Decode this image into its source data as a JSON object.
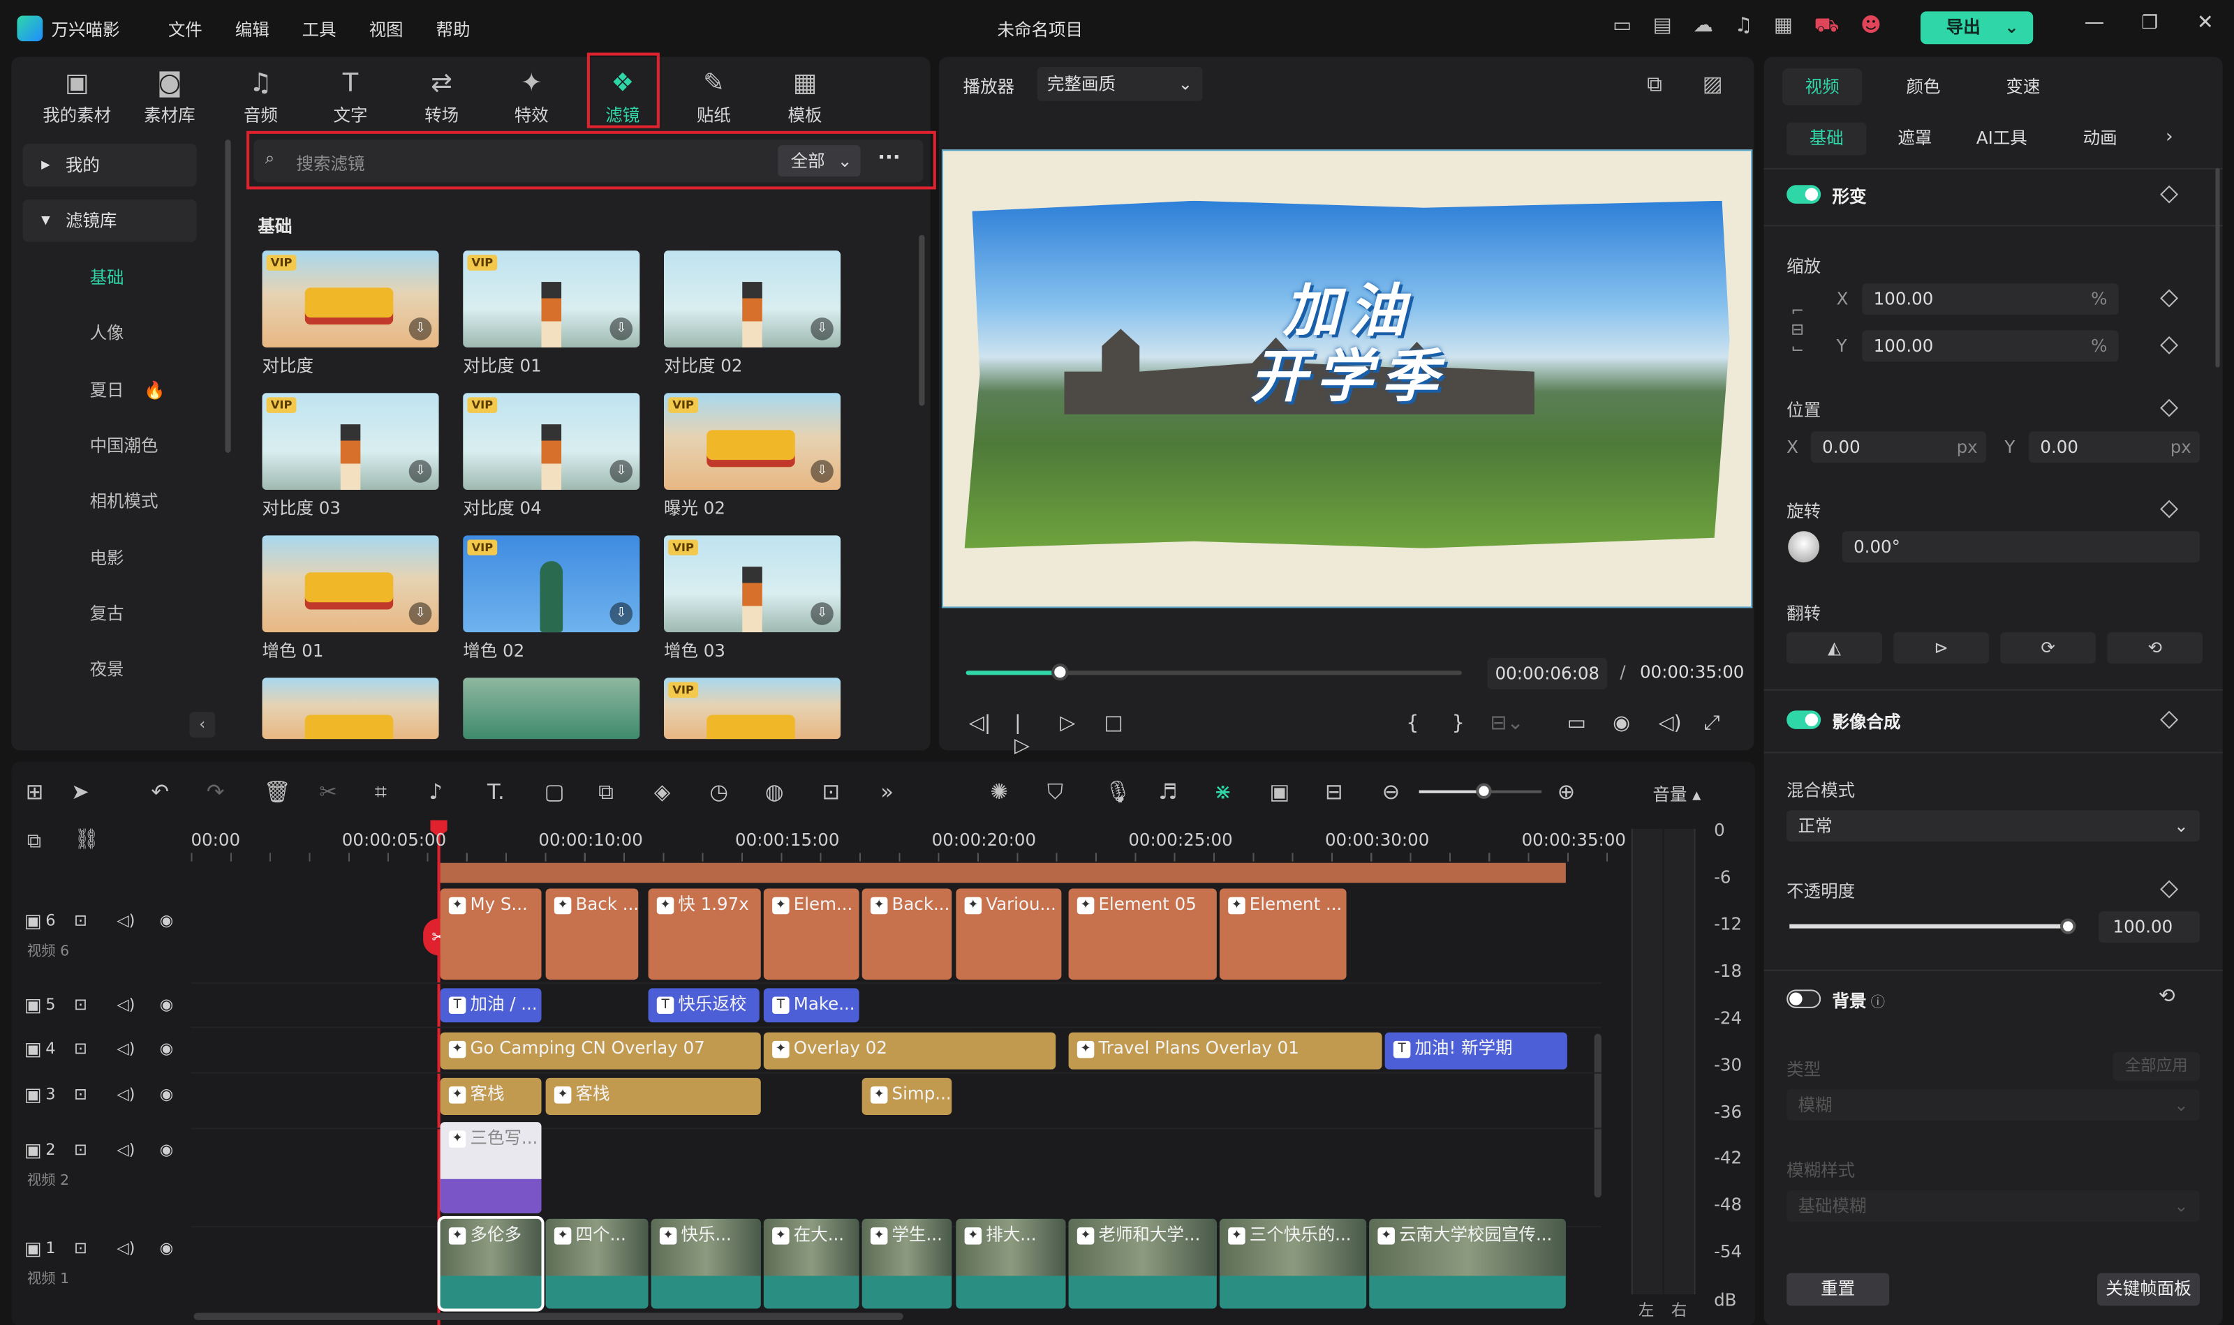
{
  "app": {
    "name": "万兴喵影",
    "project_title": "未命名项目",
    "export_label": "导出"
  },
  "menu": [
    "文件",
    "编辑",
    "工具",
    "视图",
    "帮助"
  ],
  "toolbar": [
    {
      "label": "我的素材",
      "icon": "my-assets-icon",
      "glyph": "▣"
    },
    {
      "label": "素材库",
      "icon": "library-icon",
      "glyph": "◙"
    },
    {
      "label": "音频",
      "icon": "music-note-icon",
      "glyph": "♫"
    },
    {
      "label": "文字",
      "icon": "text-icon",
      "glyph": "T"
    },
    {
      "label": "转场",
      "icon": "transition-icon",
      "glyph": "⇄"
    },
    {
      "label": "特效",
      "icon": "effects-icon",
      "glyph": "✦"
    },
    {
      "label": "滤镜",
      "icon": "filter-icon",
      "glyph": "❖",
      "active": true
    },
    {
      "label": "贴纸",
      "icon": "sticker-icon",
      "glyph": "✎"
    },
    {
      "label": "模板",
      "icon": "template-icon",
      "glyph": "▦"
    }
  ],
  "sidebar": {
    "groups": [
      {
        "label": "我的",
        "expanded": false
      },
      {
        "label": "滤镜库",
        "expanded": true
      }
    ],
    "items": [
      {
        "label": "基础",
        "active": true
      },
      {
        "label": "人像"
      },
      {
        "label": "夏日",
        "badge": "fire-icon"
      },
      {
        "label": "中国潮色"
      },
      {
        "label": "相机模式"
      },
      {
        "label": "电影"
      },
      {
        "label": "复古"
      },
      {
        "label": "夜景"
      }
    ]
  },
  "search": {
    "placeholder": "搜索滤镜",
    "filter_value": "全部",
    "more": "···"
  },
  "section_title": "基础",
  "filters": [
    {
      "label": "对比度",
      "vip": true,
      "scene": "bus"
    },
    {
      "label": "对比度 01",
      "vip": true,
      "scene": "tower"
    },
    {
      "label": "对比度 02",
      "vip": false,
      "scene": "tower"
    },
    {
      "label": "对比度 03",
      "vip": true,
      "scene": "tower"
    },
    {
      "label": "对比度 04",
      "vip": true,
      "scene": "tower"
    },
    {
      "label": "曝光 02",
      "vip": true,
      "scene": "bus"
    },
    {
      "label": "增色 01",
      "vip": false,
      "scene": "bus"
    },
    {
      "label": "增色 02",
      "vip": true,
      "scene": "tennis"
    },
    {
      "label": "增色 03",
      "vip": true,
      "scene": "tower"
    },
    {
      "label": "",
      "vip": false,
      "scene": "bus"
    },
    {
      "label": "",
      "vip": false,
      "scene": "people"
    },
    {
      "label": "",
      "vip": true,
      "scene": "bus"
    }
  ],
  "player": {
    "label": "播放器",
    "quality": "完整画质",
    "current_time": "00:00:06:08",
    "separator": "/",
    "total_time": "00:00:35:00",
    "progress": 0.19,
    "title_line1": "加油",
    "title_line2": "开学季"
  },
  "timeline": {
    "ruler": [
      "00:00",
      "00:00:05:00",
      "00:00:10:00",
      "00:00:15:00",
      "00:00:20:00",
      "00:00:25:00",
      "00:00:30:00",
      "00:00:35:00"
    ],
    "volume_label": "音量",
    "db_scale": [
      "0",
      "-6",
      "-12",
      "-18",
      "-24",
      "-30",
      "-36",
      "-42",
      "-48",
      "-54",
      "dB"
    ],
    "channels": [
      "左",
      "右"
    ],
    "tracks": [
      {
        "num": "6",
        "name": "视频 6"
      },
      {
        "num": "5",
        "name": ""
      },
      {
        "num": "4",
        "name": ""
      },
      {
        "num": "3",
        "name": ""
      },
      {
        "num": "2",
        "name": "视频 2"
      },
      {
        "num": "1",
        "name": "视频 1"
      }
    ],
    "clips": {
      "v6": [
        "My S...",
        "Back ...",
        "快 1.97x",
        "Elem...",
        "Back...",
        "Variou...",
        "Element 05",
        "Element ..."
      ],
      "v5": [
        "加油 / ...",
        "快乐返校",
        "Make..."
      ],
      "v4": [
        "Go Camping CN Overlay 07",
        "Overlay 02",
        "Travel Plans Overlay 01",
        "加油! 新学期"
      ],
      "v3": [
        "客栈",
        "客栈",
        "Simp..."
      ],
      "v2": [
        "三色写..."
      ],
      "v1": [
        "多伦多",
        "四个...",
        "快乐...",
        "在大...",
        "学生...",
        "排大...",
        "老师和大学...",
        "三个快乐的...",
        "云南大学校园宣传..."
      ]
    },
    "vip_tag": "VIP"
  },
  "right_panel": {
    "tabs": [
      "视频",
      "颜色",
      "变速"
    ],
    "subtabs": [
      "基础",
      "遮罩",
      "AI工具",
      "动画"
    ],
    "transform": {
      "label": "形变",
      "enabled": true
    },
    "scale": {
      "label": "缩放",
      "x": "100.00",
      "y": "100.00",
      "unit": "%"
    },
    "position": {
      "label": "位置",
      "x": "0.00",
      "y": "0.00",
      "unit": "px"
    },
    "rotate": {
      "label": "旋转",
      "value": "0.00°"
    },
    "flip": {
      "label": "翻转"
    },
    "composite": {
      "label": "影像合成",
      "enabled": true
    },
    "blend": {
      "label": "混合模式",
      "value": "正常"
    },
    "opacity": {
      "label": "不透明度",
      "value": "100.00",
      "level": 1.0
    },
    "background": {
      "label": "背景",
      "enabled": false
    },
    "type": {
      "label": "类型",
      "apply_all": "全部应用",
      "value": "模糊"
    },
    "blur_style": {
      "label": "模糊样式",
      "value": "基础模糊"
    },
    "reset": "重置",
    "keyframe_panel": "关键帧面板"
  },
  "axis_labels": {
    "x": "X",
    "y": "Y"
  },
  "colors": {
    "accent": "#2fd7a8",
    "highlight": "#e0222f",
    "clip_orange": "#c8714d",
    "clip_blue": "#4d5fd6",
    "clip_gold": "#c19a4f",
    "clip_teal": "#2a8f82"
  }
}
